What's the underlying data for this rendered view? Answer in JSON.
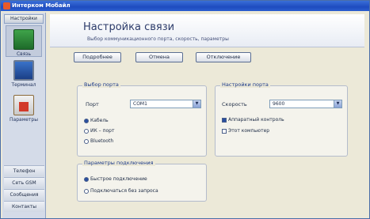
{
  "window": {
    "title": "Интерком Мобайл"
  },
  "sidebar": {
    "header": "Настройки",
    "big_items": [
      {
        "label": "Связь",
        "icon": "network-icon"
      },
      {
        "label": "Терминал",
        "icon": "monitor-icon"
      },
      {
        "label": "Параметры",
        "icon": "calendar-icon"
      }
    ],
    "list_items": [
      "Телефон",
      "Сеть GSM",
      "Сообщения",
      "Контакты"
    ]
  },
  "main": {
    "title": "Настройка связи",
    "subtitle": "Выбор коммуникационного порта, скорость, параметры",
    "buttons": [
      "Подробнее",
      "Отмена",
      "Отключение"
    ]
  },
  "port_group": {
    "legend": "Выбор порта",
    "port_label": "Порт",
    "port_value": "COM1",
    "options": [
      {
        "label": "Кабель",
        "checked": true
      },
      {
        "label": "ИК – порт",
        "checked": false
      },
      {
        "label": "Bluetooth",
        "checked": false
      }
    ]
  },
  "port_settings": {
    "legend": "Настройки порта",
    "speed_label": "Скорость",
    "speed_value": "9600",
    "options": [
      {
        "label": "Аппаратный контроль",
        "checked": true
      },
      {
        "label": "Этот компьютер",
        "checked": false
      }
    ]
  },
  "connection_group": {
    "legend": "Параметры подключения",
    "options": [
      {
        "label": "Быстрое подключение",
        "checked": true
      },
      {
        "label": "Подключаться без запроса",
        "checked": false
      }
    ]
  }
}
